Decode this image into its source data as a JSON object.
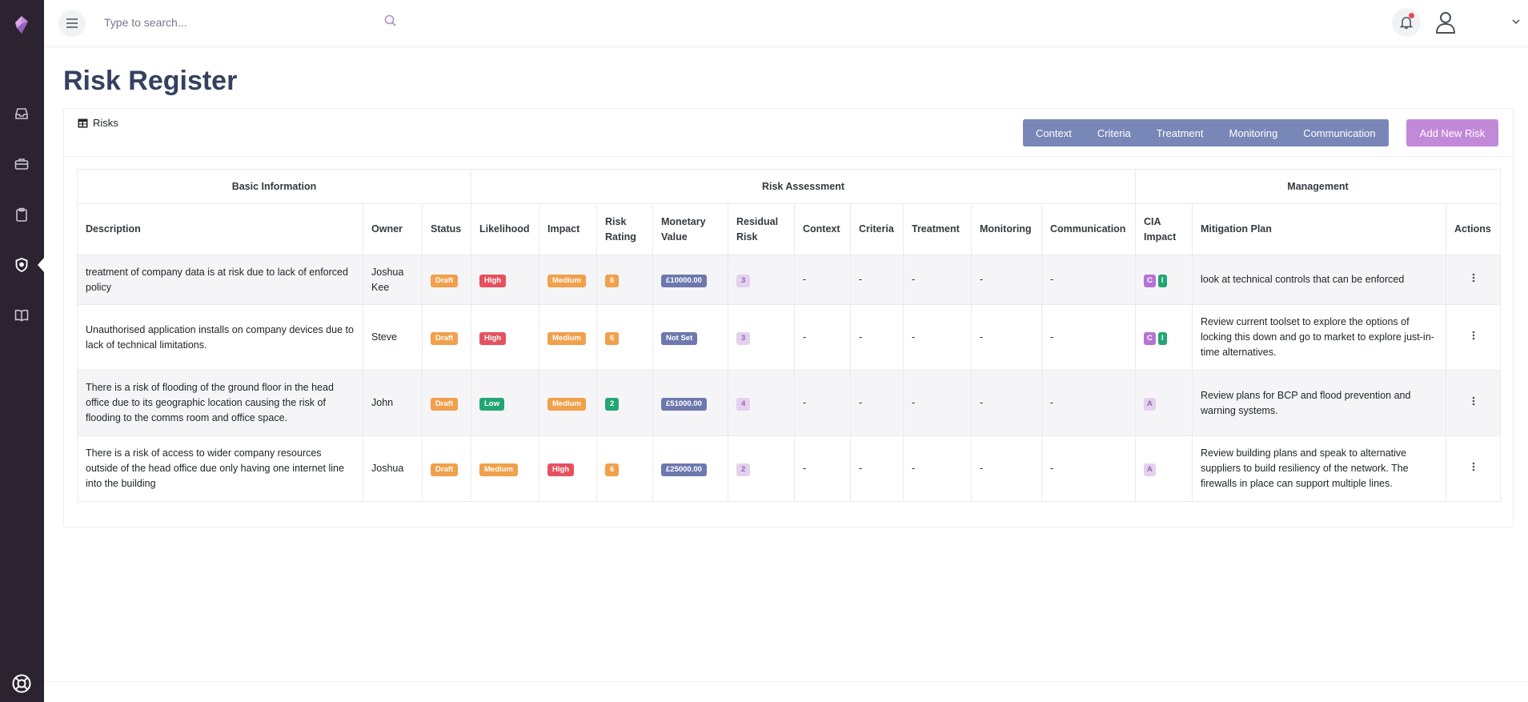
{
  "header": {
    "search_placeholder": "Type to search..."
  },
  "page": {
    "title": "Risk Register"
  },
  "card": {
    "title": "Risks",
    "buttons": [
      "Context",
      "Criteria",
      "Treatment",
      "Monitoring",
      "Communication"
    ],
    "add_button": "Add New Risk"
  },
  "table": {
    "groups": {
      "basic": "Basic Information",
      "assessment": "Risk Assessment",
      "management": "Management"
    },
    "columns": {
      "description": "Description",
      "owner": "Owner",
      "status": "Status",
      "likelihood": "Likelihood",
      "impact": "Impact",
      "risk_rating_1": "Risk",
      "risk_rating_2": "Rating",
      "monetary_1": "Monetary",
      "monetary_2": "Value",
      "residual_1": "Residual",
      "residual_2": "Risk",
      "context": "Context",
      "criteria": "Criteria",
      "treatment": "Treatment",
      "monitoring": "Monitoring",
      "communication": "Communication",
      "cia_1": "CIA",
      "cia_2": "Impact",
      "mitigation": "Mitigation Plan",
      "actions": "Actions"
    },
    "rows": [
      {
        "description": "treatment of company data is at risk due to lack of enforced policy",
        "owner": "Joshua Kee",
        "status": "Draft",
        "likelihood": "High",
        "impact": "Medium",
        "risk_rating": "6",
        "monetary": "£10000.00",
        "residual": "3",
        "context": "-",
        "criteria": "-",
        "treatment": "-",
        "monitoring": "-",
        "communication": "-",
        "cia": [
          "C",
          "I"
        ],
        "mitigation": "look at technical controls that can be enforced"
      },
      {
        "description": "Unauthorised application installs on company devices due to lack of technical limitations.",
        "owner": "Steve",
        "status": "Draft",
        "likelihood": "High",
        "impact": "Medium",
        "risk_rating": "6",
        "monetary": "Not Set",
        "residual": "3",
        "context": "-",
        "criteria": "-",
        "treatment": "-",
        "monitoring": "-",
        "communication": "-",
        "cia": [
          "C",
          "I"
        ],
        "mitigation": "Review current toolset to explore the options of locking this down and go to market to explore just-in-time alternatives."
      },
      {
        "description": "There is a risk of flooding of the ground floor in the head office due to its geographic location causing the risk of flooding to the comms room and office space.",
        "owner": "John",
        "status": "Draft",
        "likelihood": "Low",
        "impact": "Medium",
        "risk_rating": "2",
        "monetary": "£51000.00",
        "residual": "4",
        "context": "-",
        "criteria": "-",
        "treatment": "-",
        "monitoring": "-",
        "communication": "-",
        "cia": [
          "A"
        ],
        "mitigation": "Review plans for BCP and flood prevention and warning systems."
      },
      {
        "description": "There is a risk of access to wider company resources outside of the head office due only having one internet line into the building",
        "owner": "Joshua",
        "status": "Draft",
        "likelihood": "Medium",
        "impact": "High",
        "risk_rating": "6",
        "monetary": "£25000.00",
        "residual": "2",
        "context": "-",
        "criteria": "-",
        "treatment": "-",
        "monitoring": "-",
        "communication": "-",
        "cia": [
          "A"
        ],
        "mitigation": "Review building plans and speak to alternative suppliers to build resiliency of the network. The firewalls in place can support multiple lines."
      }
    ]
  },
  "colors": {
    "sidebar_bg": "#2b2430",
    "title_color": "#344160",
    "button_group_bg": "#7887b8",
    "add_button_bg": "#c289d9",
    "badge_orange": "#f1a04b",
    "badge_red": "#e5525f",
    "badge_green": "#23a674",
    "badge_blue": "#6d78ad",
    "badge_purple": "#b673d6"
  },
  "icons": {
    "sidebar": [
      "logo-icon",
      "inbox-icon",
      "briefcase-icon",
      "clipboard-icon",
      "shield-icon",
      "book-icon",
      "lifebuoy-icon"
    ],
    "header": [
      "menu-icon",
      "search-icon",
      "bell-icon",
      "user-icon",
      "chevron-down-icon"
    ],
    "card": [
      "table-icon"
    ],
    "row": [
      "dots-vertical-icon"
    ]
  }
}
